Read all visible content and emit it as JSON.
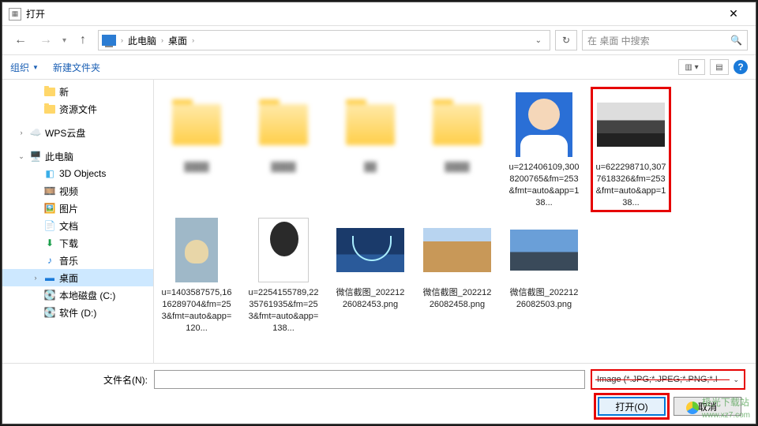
{
  "titlebar": {
    "title": "打开"
  },
  "nav": {
    "crumbs": [
      "此电脑",
      "桌面"
    ],
    "search_placeholder": "在 桌面 中搜索"
  },
  "toolbar": {
    "organize": "组织",
    "new_folder": "新建文件夹"
  },
  "tree": {
    "items": [
      {
        "label": "新",
        "kind": "folder",
        "indent": "sub"
      },
      {
        "label": "资源文件",
        "kind": "folder",
        "indent": "sub"
      },
      {
        "label": "WPS云盘",
        "kind": "cloud",
        "exp": "›"
      },
      {
        "label": "此电脑",
        "kind": "pc",
        "exp": "⌄"
      },
      {
        "label": "3D Objects",
        "kind": "3d",
        "indent": "sub"
      },
      {
        "label": "视频",
        "kind": "video",
        "indent": "sub"
      },
      {
        "label": "图片",
        "kind": "pic",
        "indent": "sub"
      },
      {
        "label": "文档",
        "kind": "doc",
        "indent": "sub"
      },
      {
        "label": "下载",
        "kind": "dl",
        "indent": "sub"
      },
      {
        "label": "音乐",
        "kind": "music",
        "indent": "sub"
      },
      {
        "label": "桌面",
        "kind": "desktop",
        "indent": "sub",
        "exp": "›",
        "selected": true
      },
      {
        "label": "本地磁盘 (C:)",
        "kind": "disk",
        "indent": "sub"
      },
      {
        "label": "软件 (D:)",
        "kind": "disk",
        "indent": "sub"
      }
    ]
  },
  "files": {
    "row1": [
      {
        "type": "folder",
        "blur": true
      },
      {
        "type": "folder",
        "blur": true
      },
      {
        "type": "folder",
        "blur": true
      },
      {
        "type": "folder",
        "blur": true
      },
      {
        "type": "portrait1",
        "label": "u=212406109,3008200765&fm=253&fmt=auto&app=138..."
      },
      {
        "type": "bwimg",
        "label": "u=622298710,3077618326&fm=253&fmt=auto&app=138...",
        "highlighted": true
      },
      {
        "type": "pug",
        "label": "u=1403587575,1616289704&fm=253&fmt=auto&app=120..."
      }
    ],
    "row2": [
      {
        "type": "portrait2",
        "label": "u=2254155789,2235761935&fm=253&fmt=auto&app=138..."
      },
      {
        "type": "bridge",
        "label": "微信截图_202212260824​53.png"
      },
      {
        "type": "village",
        "label": "微信截图_202212260824​58.png"
      },
      {
        "type": "city",
        "label": "微信截图_202212260825​03.png"
      }
    ]
  },
  "footer": {
    "filename_label": "文件名(N):",
    "filetype": "Image (*.JPG;*.JPEG;*.PNG;*.I",
    "open": "打开(O)",
    "cancel": "取消"
  },
  "watermark": {
    "text": "极光下载站",
    "url": "www.xz7.com"
  }
}
